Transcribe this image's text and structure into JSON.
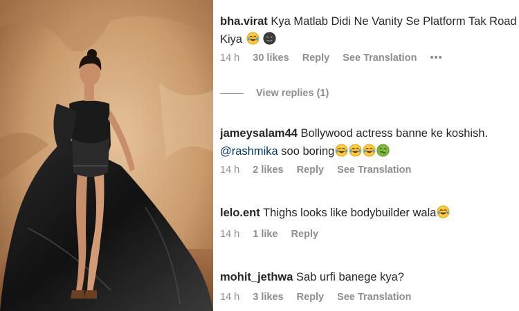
{
  "photo": {
    "alt_name": "actress-photo"
  },
  "comments": [
    {
      "username": "bha.virat",
      "text_line1": "Kya Matlab Didi Ne Vanity Se Platform Tak Road",
      "text_line2": "Kiya",
      "emojis": [
        "laughing-tears-emoji",
        "dark-face-emoji"
      ],
      "time": "14 h",
      "likes": "30 likes",
      "reply": "Reply",
      "translation": "See Translation",
      "more": "•••"
    },
    {
      "username": "jameysalam44",
      "text_line1": "Bollywood actress banne ke koshish.",
      "mention": "@rashmika",
      "text_line2": "soo boring",
      "emojis": [
        "laughing-tears-emoji",
        "laughing-tears-emoji",
        "laughing-tears-emoji",
        "nauseated-face-emoji"
      ],
      "time": "14 h",
      "likes": "2 likes",
      "reply": "Reply",
      "translation": "See Translation"
    },
    {
      "username": "lelo.ent",
      "text_line1": "Thighs looks like bodybuilder wala",
      "emojis": [
        "laughing-tears-emoji"
      ],
      "time": "14 h",
      "likes": "1 like",
      "reply": "Reply"
    },
    {
      "username": "mohit_jethwa",
      "text_line1": "Sab urfi banege kya?",
      "time": "14 h",
      "likes": "3 likes",
      "reply": "Reply",
      "translation": "See Translation"
    }
  ],
  "view_replies": "View replies (1)",
  "colors": {
    "username": "#262626",
    "meta": "#8e8e8e",
    "mention": "#00376b",
    "backdrop": "#c99a6b"
  }
}
